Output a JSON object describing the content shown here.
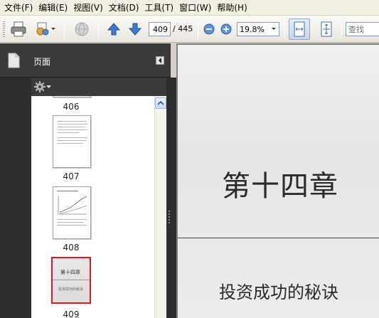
{
  "menubar": {
    "items": [
      "文件(F)",
      "编辑(E)",
      "视图(V)",
      "文档(D)",
      "工具(T)",
      "窗口(W)",
      "帮助(H)"
    ]
  },
  "toolbar": {
    "current_page": "409",
    "total_pages": "/ 445",
    "zoom": "19.8%",
    "search_placeholder": "查找"
  },
  "panel": {
    "title": "页面",
    "thumbnails": [
      {
        "label": "406"
      },
      {
        "label": "407"
      },
      {
        "label": "408"
      },
      {
        "label": "409",
        "selected": true
      }
    ],
    "selected_thumb_text": {
      "title": "第十四章",
      "subtitle": "投资成功的秘诀"
    }
  },
  "document": {
    "chapter_title": "第十四章",
    "subtitle": "投资成功的秘诀"
  },
  "colors": {
    "selection_border": "#e0171f",
    "accent_blue": "#3a7bd5",
    "panel_dark": "#2d2d2d"
  }
}
